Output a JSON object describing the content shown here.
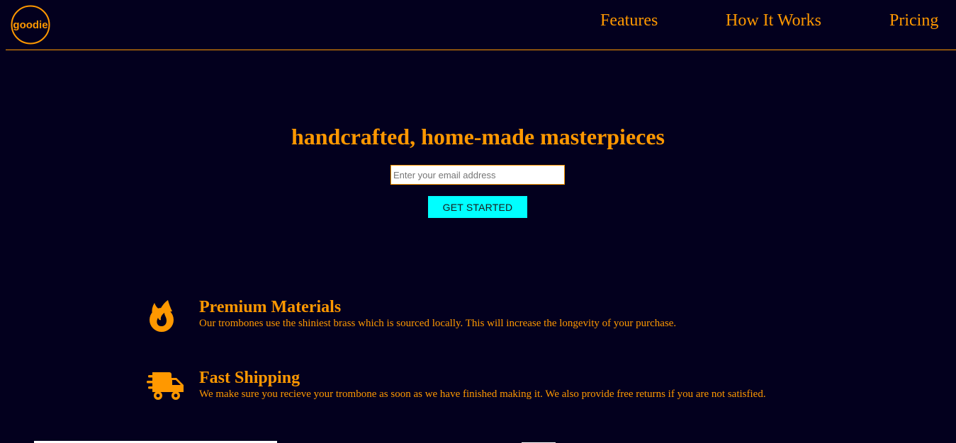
{
  "header": {
    "logo_text": "goodie",
    "nav": {
      "features": "Features",
      "how_it_works": "How It Works",
      "pricing": "Pricing"
    }
  },
  "hero": {
    "title": "handcrafted, home-made masterpieces",
    "email_placeholder": "Enter your email address",
    "cta_label": "GET STARTED"
  },
  "features": [
    {
      "icon": "fire-icon",
      "title": "Premium Materials",
      "description": "Our trombones use the shiniest brass which is sourced locally. This will increase the longevity of your purchase."
    },
    {
      "icon": "shipping-truck-icon",
      "title": "Fast Shipping",
      "description": "We make sure you recieve your trombone as soon as we have finished making it. We also provide free returns if you are not satisfied."
    }
  ],
  "colors": {
    "background": "#03001e",
    "accent": "#ff9800",
    "button": "#00ffff"
  }
}
